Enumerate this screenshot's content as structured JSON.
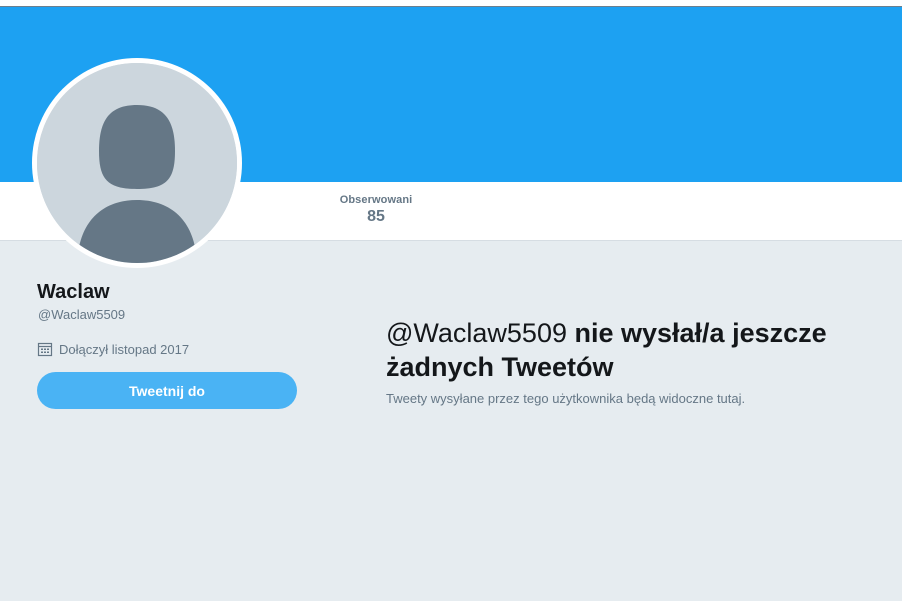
{
  "theme": {
    "banner_color": "#1da1f2",
    "button_color": "#4ab3f4",
    "background_color": "#e6ecf0",
    "muted_text_color": "#657786"
  },
  "nav": {
    "stats": [
      {
        "label": "Obserwowani",
        "value": "85"
      }
    ]
  },
  "profile": {
    "avatar_icon": "default-user-silhouette-icon",
    "name": "Waclaw",
    "handle": "@Waclaw5509",
    "joined_icon": "calendar-icon",
    "joined": "Dołączył listopad 2017",
    "tweet_to_button": "Tweetnij do"
  },
  "timeline": {
    "empty_handle": "@Waclaw5509",
    "empty_message": " nie wysłał/a jeszcze żadnych Tweetów",
    "empty_subtitle": "Tweety wysyłane przez tego użytkownika będą widoczne tutaj."
  }
}
